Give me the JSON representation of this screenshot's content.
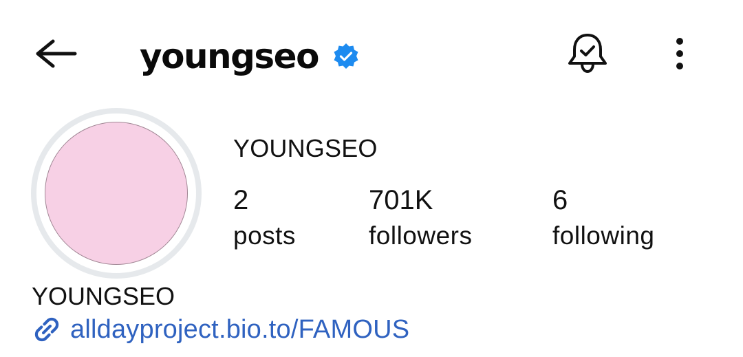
{
  "header": {
    "username": "youngseo",
    "verified": true,
    "icons": {
      "back": "back-arrow-icon",
      "verified": "verified-badge-icon",
      "notifications": "bell-check-icon",
      "more": "more-vertical-icon"
    }
  },
  "profile": {
    "display_name": "YOUNGSEO",
    "avatar_color": "#f7d0e5",
    "stats": [
      {
        "value": "2",
        "label": "posts"
      },
      {
        "value": "701K",
        "label": "followers"
      },
      {
        "value": "6",
        "label": "following"
      }
    ]
  },
  "bio": {
    "name": "YOUNGSEO",
    "link": "alldayproject.bio.to/FAMOUS",
    "link_icon": "link-icon"
  },
  "colors": {
    "verified_blue": "#1d8bf0",
    "link_blue": "#2f62c0",
    "ring_gray": "#e6e9ec"
  }
}
